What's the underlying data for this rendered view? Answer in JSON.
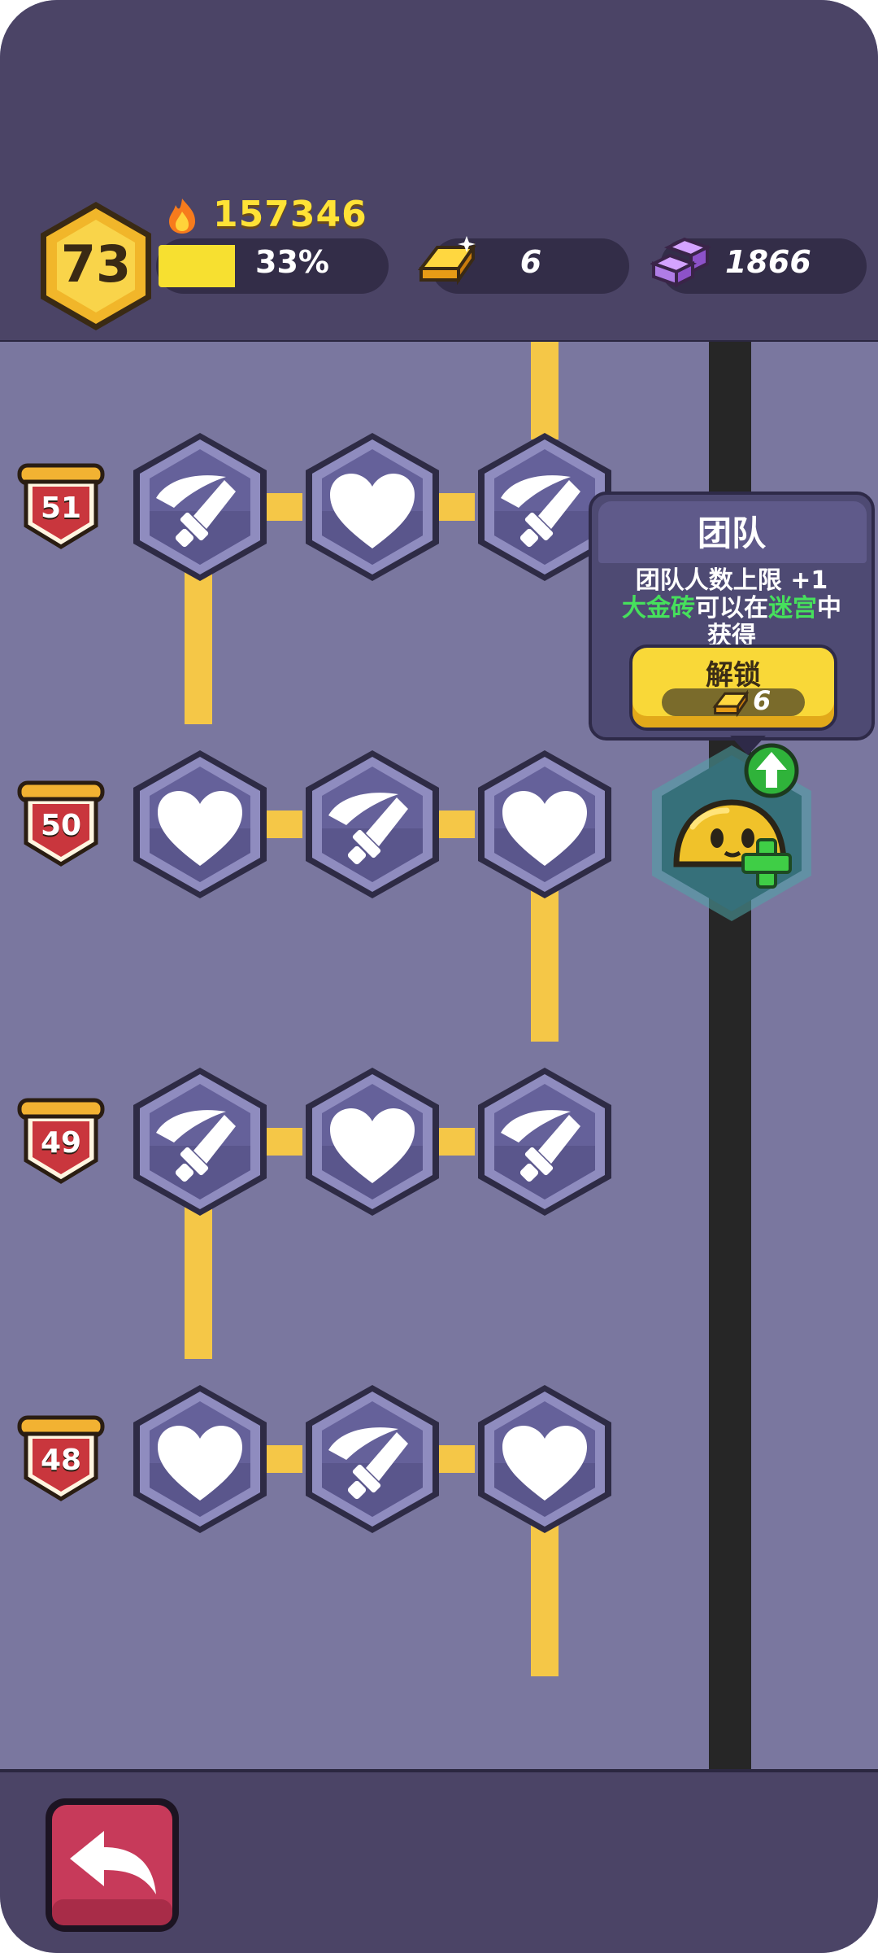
{
  "player": {
    "level": "73",
    "score": "157346",
    "xp_percent_label": "33%",
    "xp_progress": 0.33
  },
  "currencies": {
    "gold_bars": "6",
    "gems": "1866"
  },
  "rows": [
    {
      "level": "51",
      "nodes": [
        "sword-icon",
        "heart-icon",
        "sword-icon"
      ]
    },
    {
      "level": "50",
      "nodes": [
        "heart-icon",
        "sword-icon",
        "heart-icon"
      ]
    },
    {
      "level": "49",
      "nodes": [
        "sword-icon",
        "heart-icon",
        "sword-icon"
      ]
    },
    {
      "level": "48",
      "nodes": [
        "heart-icon",
        "sword-icon",
        "heart-icon"
      ]
    }
  ],
  "tooltip": {
    "title": "团队",
    "line1": "团队人数上限 +1",
    "line2_hl1": "大金砖",
    "line2_mid": "可以在",
    "line2_hl2": "迷宫",
    "line2_end": "中",
    "line3": "获得",
    "unlock_label": "解锁",
    "unlock_cost": "6"
  },
  "colors": {
    "header_bg": "#4b4466",
    "board_bg": "#7a779f",
    "connector": "#f5c747",
    "node_face": "#65619a",
    "highlight_green": "#46e05c",
    "back_button": "#c73a5a"
  }
}
